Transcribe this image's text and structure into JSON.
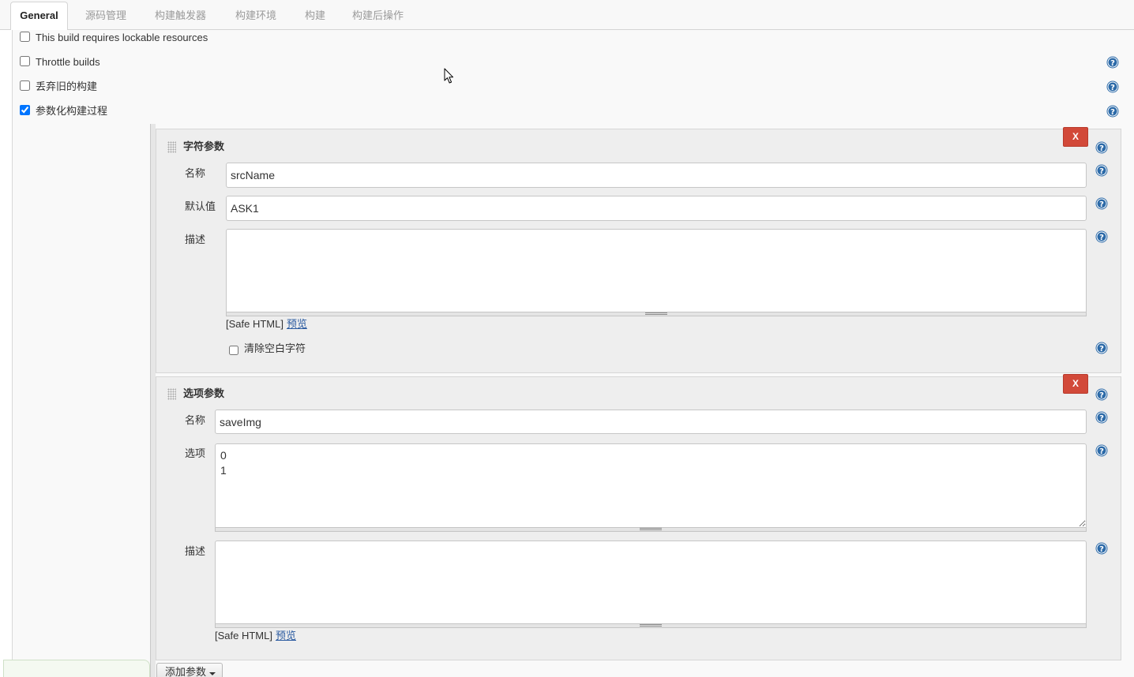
{
  "tabs": [
    {
      "label": "General",
      "active": true
    },
    {
      "label": "源码管理",
      "active": false
    },
    {
      "label": "构建触发器",
      "active": false
    },
    {
      "label": "构建环境",
      "active": false
    },
    {
      "label": "构建",
      "active": false
    },
    {
      "label": "构建后操作",
      "active": false
    }
  ],
  "general_options": [
    {
      "label": "This build requires lockable resources",
      "checked": false
    },
    {
      "label": "Throttle builds",
      "checked": false
    },
    {
      "label": "丢弃旧的构建",
      "checked": false
    },
    {
      "label": "参数化构建过程",
      "checked": true
    }
  ],
  "parameters": [
    {
      "title": "字符参数",
      "delete_label": "X",
      "fields": {
        "name": {
          "label": "名称",
          "value": "srcName"
        },
        "default_value": {
          "label": "默认值",
          "value": "ASK1"
        },
        "description": {
          "label": "描述"
        }
      },
      "safe_html_note": "[Safe HTML]",
      "preview_link": "预览",
      "trim": {
        "label": "清除空白字符",
        "checked": false
      }
    },
    {
      "title": "选项参数",
      "delete_label": "X",
      "fields": {
        "name": {
          "label": "名称",
          "value": "saveImg"
        },
        "choices": {
          "label": "选项",
          "value": "0\n1"
        },
        "description": {
          "label": "描述"
        }
      },
      "safe_html_note": "[Safe HTML]",
      "preview_link": "预览"
    }
  ],
  "add_parameter_button": {
    "label": "添加参数"
  },
  "icons": {
    "help": "help-icon",
    "drag": "drag-handle-icon",
    "dropdown": "caret-down-icon",
    "pointer": "mouse-pointer-icon"
  },
  "colors": {
    "delete_button": "#d24939",
    "help_icon": "#2c6aa8",
    "link": "#2a5aa0",
    "inactive_tab_text": "#9a9a9a",
    "panel_background": "#f9f9f9",
    "parameter_background": "#eeeeee"
  }
}
